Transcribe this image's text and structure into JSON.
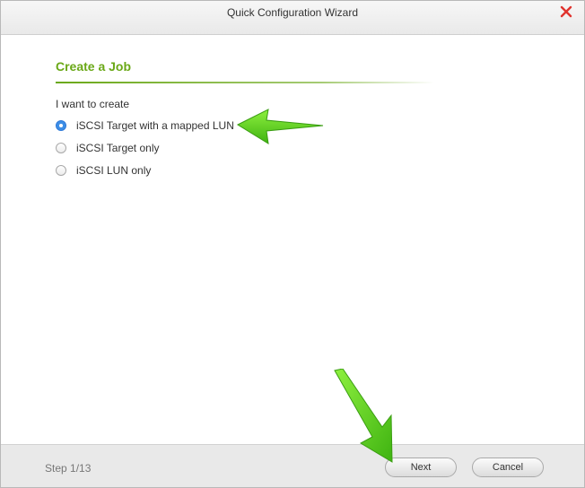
{
  "window": {
    "title": "Quick Configuration Wizard",
    "close_icon": "close-icon",
    "close_color": "#e0332e"
  },
  "section": {
    "title": "Create a Job",
    "accent_color": "#6aa817"
  },
  "form": {
    "prompt": "I want to create",
    "options": [
      {
        "label": "iSCSI Target with a mapped LUN",
        "selected": true
      },
      {
        "label": "iSCSI Target only",
        "selected": false
      },
      {
        "label": "iSCSI LUN only",
        "selected": false
      }
    ]
  },
  "footer": {
    "step": "Step 1/13",
    "next_label": "Next",
    "cancel_label": "Cancel"
  },
  "annotations": {
    "arrow_color": "#5fd11f",
    "icons": [
      "green-arrow-icon",
      "green-arrow-icon"
    ]
  }
}
